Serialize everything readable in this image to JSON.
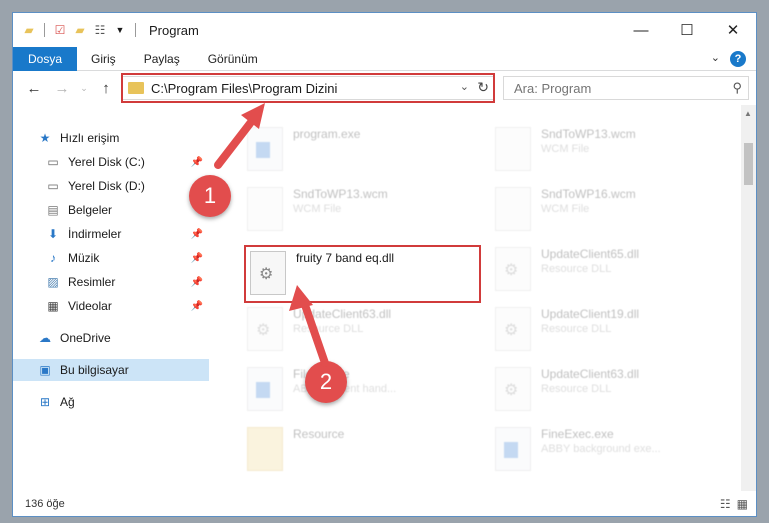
{
  "window": {
    "title": "Program"
  },
  "titlebar": {
    "minimize_glyph": "—",
    "maximize_glyph": "☐",
    "close_glyph": "✕"
  },
  "ribbon": {
    "tabs": [
      {
        "label": "Dosya",
        "active": true
      },
      {
        "label": "Giriş"
      },
      {
        "label": "Paylaş"
      },
      {
        "label": "Görünüm"
      }
    ],
    "help_label": "?"
  },
  "address": {
    "path": "C:\\Program Files\\Program Dizini"
  },
  "search": {
    "placeholder": "Ara: Program"
  },
  "sidebar": {
    "items": [
      {
        "label": "Hızlı erişim",
        "icon": "star-icon"
      },
      {
        "label": "Yerel Disk (C:)",
        "icon": "drive-icon"
      },
      {
        "label": "Yerel Disk (D:)",
        "icon": "drive-icon"
      },
      {
        "label": "Belgeler",
        "icon": "documents-icon"
      },
      {
        "label": "İndirmeler",
        "icon": "download-icon"
      },
      {
        "label": "Müzik",
        "icon": "music-icon"
      },
      {
        "label": "Resimler",
        "icon": "pictures-icon"
      },
      {
        "label": "Videolar",
        "icon": "video-icon"
      },
      {
        "label": "OneDrive",
        "icon": "cloud-icon"
      },
      {
        "label": "Bu bilgisayar",
        "icon": "computer-icon"
      },
      {
        "label": "Ağ",
        "icon": "network-icon"
      }
    ]
  },
  "files": [
    {
      "name": "program.exe",
      "type": ""
    },
    {
      "name": "SndToWP13.wcm",
      "type": "WCM File"
    },
    {
      "name": "SndToWP13.wcm",
      "type": "WCM File"
    },
    {
      "name": "SndToWP16.wcm",
      "type": "WCM File"
    },
    {
      "name": "fruity 7 band eq.dll",
      "type": ""
    },
    {
      "name": "UpdateClient65.dll",
      "type": "Resource DLL"
    },
    {
      "name": "UpdateClient63.dll",
      "type": "Resource DLL"
    },
    {
      "name": "UpdateClient19.dll",
      "type": "Resource DLL"
    },
    {
      "name": "FileS7.exe",
      "type": "ABBYY event hand..."
    },
    {
      "name": "UpdateClient63.dll",
      "type": "Resource DLL"
    },
    {
      "name": "Resource",
      "type": ""
    },
    {
      "name": "FineExec.exe",
      "type": "ABBY background exe..."
    }
  ],
  "annotations": {
    "step1": "1",
    "step2": "2",
    "highlight_color": "#d13b3b"
  },
  "status": {
    "item_count": "136 öğe"
  },
  "colors": {
    "accent": "#1979ca",
    "selection": "#cce4f7"
  }
}
